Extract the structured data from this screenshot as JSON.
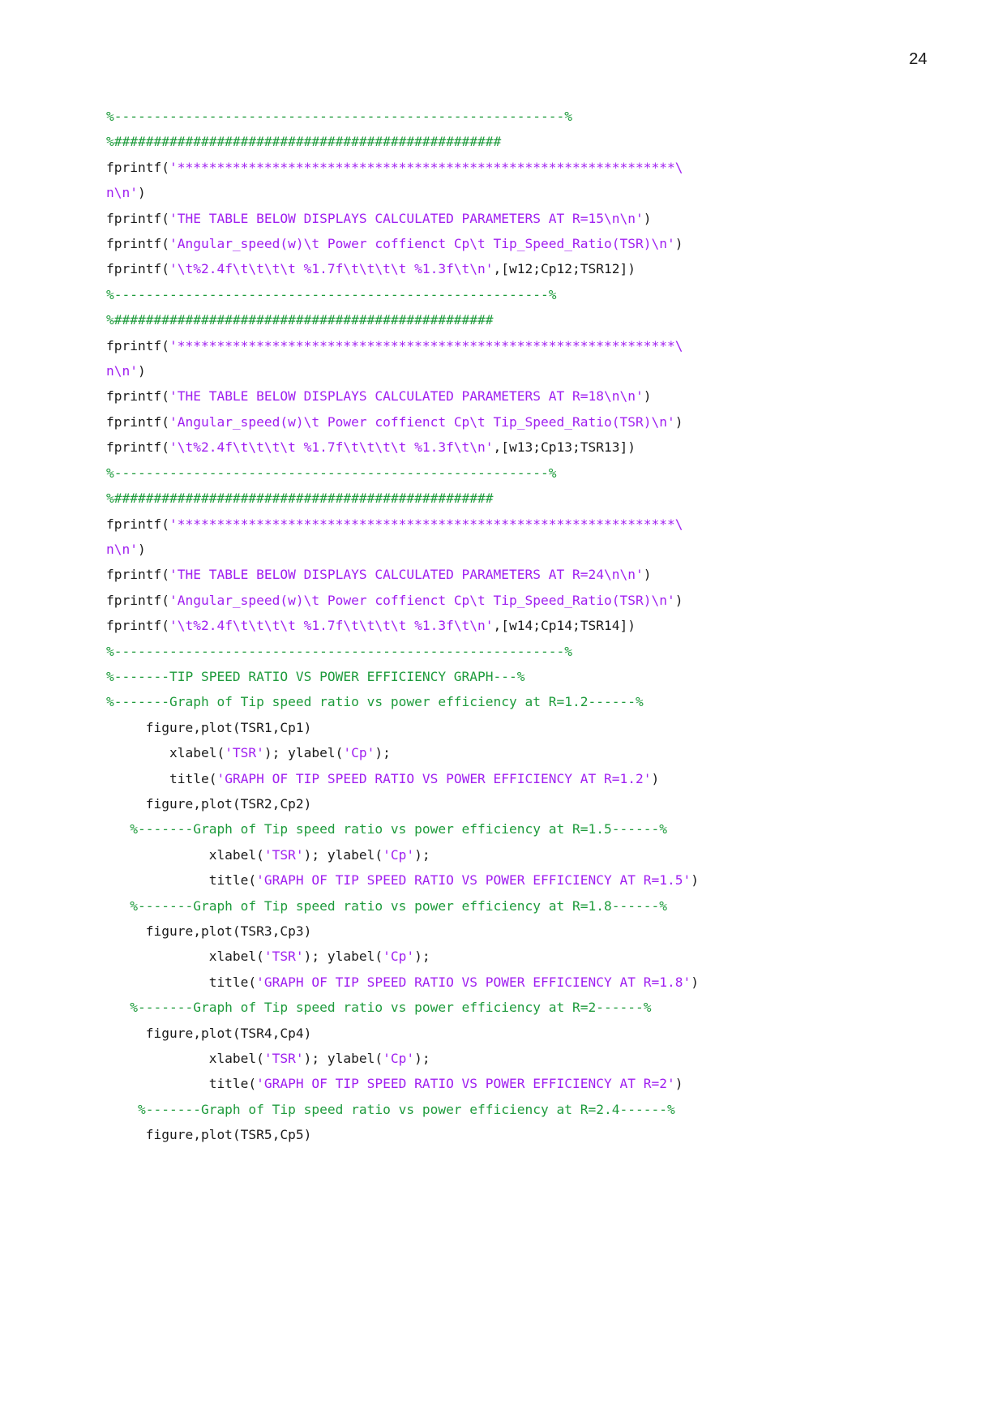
{
  "document": {
    "page_number": "24",
    "language": "matlab",
    "colors": {
      "comment": "#1e9b3c",
      "string": "#a020f0",
      "plain": "#1a1a1a",
      "background": "#ffffff"
    }
  },
  "code": {
    "lines": [
      {
        "id": "l1",
        "indent": 0,
        "segments": [
          {
            "t": "comment",
            "v": "%---------------------------------------------------------%"
          }
        ]
      },
      {
        "id": "l2",
        "indent": 0,
        "segments": [
          {
            "t": "comment",
            "v": "%#################################################"
          }
        ]
      },
      {
        "id": "l3",
        "indent": 0,
        "segments": [
          {
            "t": "plain",
            "v": "fprintf("
          },
          {
            "t": "string",
            "v": "'***************************************************************\\"
          }
        ]
      },
      {
        "id": "l4",
        "indent": 0,
        "segments": [
          {
            "t": "string",
            "v": "n\\n'"
          },
          {
            "t": "plain",
            "v": ")"
          }
        ]
      },
      {
        "id": "l5",
        "indent": 0,
        "segments": [
          {
            "t": "plain",
            "v": "fprintf("
          },
          {
            "t": "string",
            "v": "'THE TABLE BELOW DISPLAYS CALCULATED PARAMETERS AT R=15\\n\\n'"
          },
          {
            "t": "plain",
            "v": ")"
          }
        ]
      },
      {
        "id": "l6",
        "indent": 0,
        "segments": [
          {
            "t": "plain",
            "v": "fprintf("
          },
          {
            "t": "string",
            "v": "'Angular_speed(w)\\t Power coffienct Cp\\t Tip_Speed_Ratio(TSR)\\n'"
          },
          {
            "t": "plain",
            "v": ")"
          }
        ]
      },
      {
        "id": "l7",
        "indent": 0,
        "segments": [
          {
            "t": "plain",
            "v": "fprintf("
          },
          {
            "t": "string",
            "v": "'\\t%2.4f\\t\\t\\t\\t %1.7f\\t\\t\\t\\t %1.3f\\t\\n'"
          },
          {
            "t": "plain",
            "v": ",[w12;Cp12;TSR12])"
          }
        ]
      },
      {
        "id": "l8",
        "indent": 0,
        "segments": [
          {
            "t": "comment",
            "v": "%-------------------------------------------------------%"
          }
        ]
      },
      {
        "id": "l9",
        "indent": 0,
        "segments": [
          {
            "t": "comment",
            "v": "%################################################"
          }
        ]
      },
      {
        "id": "l10",
        "indent": 0,
        "segments": [
          {
            "t": "plain",
            "v": "fprintf("
          },
          {
            "t": "string",
            "v": "'***************************************************************\\"
          }
        ]
      },
      {
        "id": "l11",
        "indent": 0,
        "segments": [
          {
            "t": "string",
            "v": "n\\n'"
          },
          {
            "t": "plain",
            "v": ")"
          }
        ]
      },
      {
        "id": "l12",
        "indent": 0,
        "segments": [
          {
            "t": "plain",
            "v": "fprintf("
          },
          {
            "t": "string",
            "v": "'THE TABLE BELOW DISPLAYS CALCULATED PARAMETERS AT R=18\\n\\n'"
          },
          {
            "t": "plain",
            "v": ")"
          }
        ]
      },
      {
        "id": "l13",
        "indent": 0,
        "segments": [
          {
            "t": "plain",
            "v": "fprintf("
          },
          {
            "t": "string",
            "v": "'Angular_speed(w)\\t Power coffienct Cp\\t Tip_Speed_Ratio(TSR)\\n'"
          },
          {
            "t": "plain",
            "v": ")"
          }
        ]
      },
      {
        "id": "l14",
        "indent": 0,
        "segments": [
          {
            "t": "plain",
            "v": "fprintf("
          },
          {
            "t": "string",
            "v": "'\\t%2.4f\\t\\t\\t\\t %1.7f\\t\\t\\t\\t %1.3f\\t\\n'"
          },
          {
            "t": "plain",
            "v": ",[w13;Cp13;TSR13])"
          }
        ]
      },
      {
        "id": "l15",
        "indent": 0,
        "segments": [
          {
            "t": "comment",
            "v": "%-------------------------------------------------------%"
          }
        ]
      },
      {
        "id": "l16",
        "indent": 0,
        "segments": [
          {
            "t": "comment",
            "v": "%################################################"
          }
        ]
      },
      {
        "id": "l17",
        "indent": 0,
        "segments": [
          {
            "t": "plain",
            "v": "fprintf("
          },
          {
            "t": "string",
            "v": "'***************************************************************\\"
          }
        ]
      },
      {
        "id": "l18",
        "indent": 0,
        "segments": [
          {
            "t": "string",
            "v": "n\\n'"
          },
          {
            "t": "plain",
            "v": ")"
          }
        ]
      },
      {
        "id": "l19",
        "indent": 0,
        "segments": [
          {
            "t": "plain",
            "v": "fprintf("
          },
          {
            "t": "string",
            "v": "'THE TABLE BELOW DISPLAYS CALCULATED PARAMETERS AT R=24\\n\\n'"
          },
          {
            "t": "plain",
            "v": ")"
          }
        ]
      },
      {
        "id": "l20",
        "indent": 0,
        "segments": [
          {
            "t": "plain",
            "v": "fprintf("
          },
          {
            "t": "string",
            "v": "'Angular_speed(w)\\t Power coffienct Cp\\t Tip_Speed_Ratio(TSR)\\n'"
          },
          {
            "t": "plain",
            "v": ")"
          }
        ]
      },
      {
        "id": "l21",
        "indent": 0,
        "segments": [
          {
            "t": "plain",
            "v": "fprintf("
          },
          {
            "t": "string",
            "v": "'\\t%2.4f\\t\\t\\t\\t %1.7f\\t\\t\\t\\t %1.3f\\t\\n'"
          },
          {
            "t": "plain",
            "v": ",[w14;Cp14;TSR14])"
          }
        ]
      },
      {
        "id": "l22",
        "indent": 0,
        "segments": [
          {
            "t": "comment",
            "v": "%---------------------------------------------------------%"
          }
        ]
      },
      {
        "id": "l23",
        "indent": 0,
        "segments": [
          {
            "t": "comment",
            "v": "%-------TIP SPEED RATIO VS POWER EFFICIENCY GRAPH---%"
          }
        ]
      },
      {
        "id": "l24",
        "indent": 0,
        "segments": [
          {
            "t": "comment",
            "v": "%-------Graph of Tip speed ratio vs power efficiency at R=1.2------%"
          }
        ]
      },
      {
        "id": "l25",
        "indent": 0,
        "segments": [
          {
            "t": "plain",
            "v": "     figure,plot(TSR1,Cp1)"
          }
        ]
      },
      {
        "id": "l26",
        "indent": 0,
        "segments": [
          {
            "t": "plain",
            "v": "        xlabel("
          },
          {
            "t": "string",
            "v": "'TSR'"
          },
          {
            "t": "plain",
            "v": "); ylabel("
          },
          {
            "t": "string",
            "v": "'Cp'"
          },
          {
            "t": "plain",
            "v": ");"
          }
        ]
      },
      {
        "id": "l27",
        "indent": 0,
        "segments": [
          {
            "t": "plain",
            "v": "        title("
          },
          {
            "t": "string",
            "v": "'GRAPH OF TIP SPEED RATIO VS POWER EFFICIENCY AT R=1.2'"
          },
          {
            "t": "plain",
            "v": ")"
          }
        ]
      },
      {
        "id": "l28",
        "indent": 0,
        "segments": [
          {
            "t": "plain",
            "v": "     figure,plot(TSR2,Cp2)"
          }
        ]
      },
      {
        "id": "l29",
        "indent": 0,
        "segments": [
          {
            "t": "comment",
            "v": "   %-------Graph of Tip speed ratio vs power efficiency at R=1.5------%"
          }
        ]
      },
      {
        "id": "l30",
        "indent": 0,
        "segments": [
          {
            "t": "plain",
            "v": "             xlabel("
          },
          {
            "t": "string",
            "v": "'TSR'"
          },
          {
            "t": "plain",
            "v": "); ylabel("
          },
          {
            "t": "string",
            "v": "'Cp'"
          },
          {
            "t": "plain",
            "v": ");"
          }
        ]
      },
      {
        "id": "l31",
        "indent": 0,
        "segments": [
          {
            "t": "plain",
            "v": "             title("
          },
          {
            "t": "string",
            "v": "'GRAPH OF TIP SPEED RATIO VS POWER EFFICIENCY AT R=1.5'"
          },
          {
            "t": "plain",
            "v": ")"
          }
        ]
      },
      {
        "id": "l32",
        "indent": 0,
        "segments": [
          {
            "t": "comment",
            "v": "   %-------Graph of Tip speed ratio vs power efficiency at R=1.8------%"
          }
        ]
      },
      {
        "id": "l33",
        "indent": 0,
        "segments": [
          {
            "t": "plain",
            "v": "     figure,plot(TSR3,Cp3)"
          }
        ]
      },
      {
        "id": "l34",
        "indent": 0,
        "segments": [
          {
            "t": "plain",
            "v": "             xlabel("
          },
          {
            "t": "string",
            "v": "'TSR'"
          },
          {
            "t": "plain",
            "v": "); ylabel("
          },
          {
            "t": "string",
            "v": "'Cp'"
          },
          {
            "t": "plain",
            "v": ");"
          }
        ]
      },
      {
        "id": "l35",
        "indent": 0,
        "segments": [
          {
            "t": "plain",
            "v": "             title("
          },
          {
            "t": "string",
            "v": "'GRAPH OF TIP SPEED RATIO VS POWER EFFICIENCY AT R=1.8'"
          },
          {
            "t": "plain",
            "v": ")"
          }
        ]
      },
      {
        "id": "l36",
        "indent": 0,
        "segments": [
          {
            "t": "comment",
            "v": "   %-------Graph of Tip speed ratio vs power efficiency at R=2------%"
          }
        ]
      },
      {
        "id": "l37",
        "indent": 0,
        "segments": [
          {
            "t": "plain",
            "v": "     figure,plot(TSR4,Cp4)"
          }
        ]
      },
      {
        "id": "l38",
        "indent": 0,
        "segments": [
          {
            "t": "plain",
            "v": "             xlabel("
          },
          {
            "t": "string",
            "v": "'TSR'"
          },
          {
            "t": "plain",
            "v": "); ylabel("
          },
          {
            "t": "string",
            "v": "'Cp'"
          },
          {
            "t": "plain",
            "v": ");"
          }
        ]
      },
      {
        "id": "l39",
        "indent": 0,
        "segments": [
          {
            "t": "plain",
            "v": "             title("
          },
          {
            "t": "string",
            "v": "'GRAPH OF TIP SPEED RATIO VS POWER EFFICIENCY AT R=2'"
          },
          {
            "t": "plain",
            "v": ")"
          }
        ]
      },
      {
        "id": "l40",
        "indent": 0,
        "segments": [
          {
            "t": "comment",
            "v": "    %-------Graph of Tip speed ratio vs power efficiency at R=2.4------%"
          }
        ]
      },
      {
        "id": "l41",
        "indent": 0,
        "segments": [
          {
            "t": "plain",
            "v": "     figure,plot(TSR5,Cp5)"
          }
        ]
      }
    ]
  }
}
